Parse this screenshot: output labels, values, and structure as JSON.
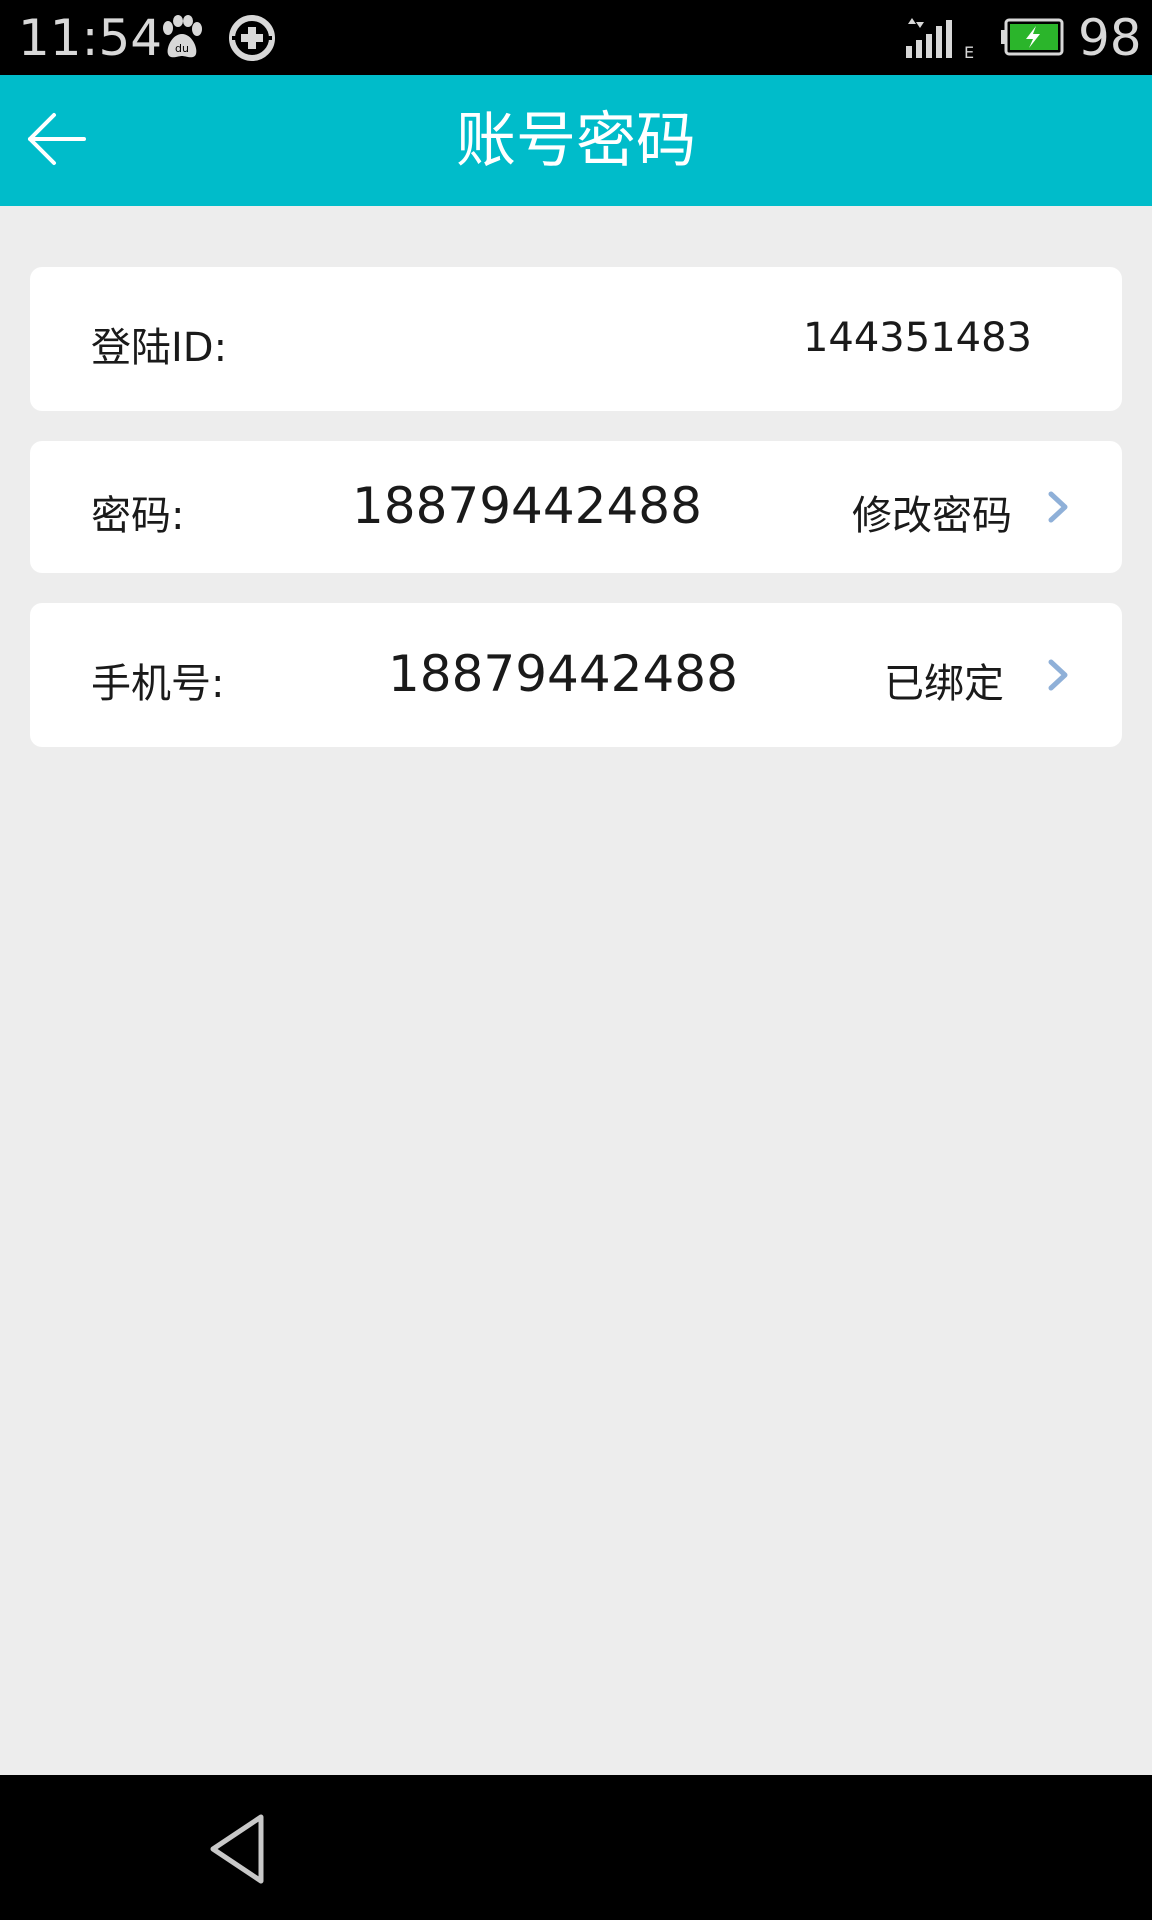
{
  "status_bar": {
    "time": "11:54",
    "battery_level": "98",
    "icons": [
      "paw-icon",
      "sync-icon",
      "signal-icon",
      "battery-icon"
    ]
  },
  "app_bar": {
    "title": "账号密码",
    "back_icon": "arrow-left-icon",
    "color": "#00bcca"
  },
  "rows": {
    "login_id": {
      "label": "登陆ID:",
      "value": "144351483"
    },
    "password": {
      "label": "密码:",
      "value": "18879442488",
      "action": "修改密码"
    },
    "phone": {
      "label": "手机号:",
      "value": "18879442488",
      "action": "已绑定"
    }
  },
  "nav_bar": {
    "back_icon": "triangle-back-icon"
  },
  "colors": {
    "accent": "#00bcca",
    "background": "#ededed",
    "chevron": "#8fb0d8"
  }
}
